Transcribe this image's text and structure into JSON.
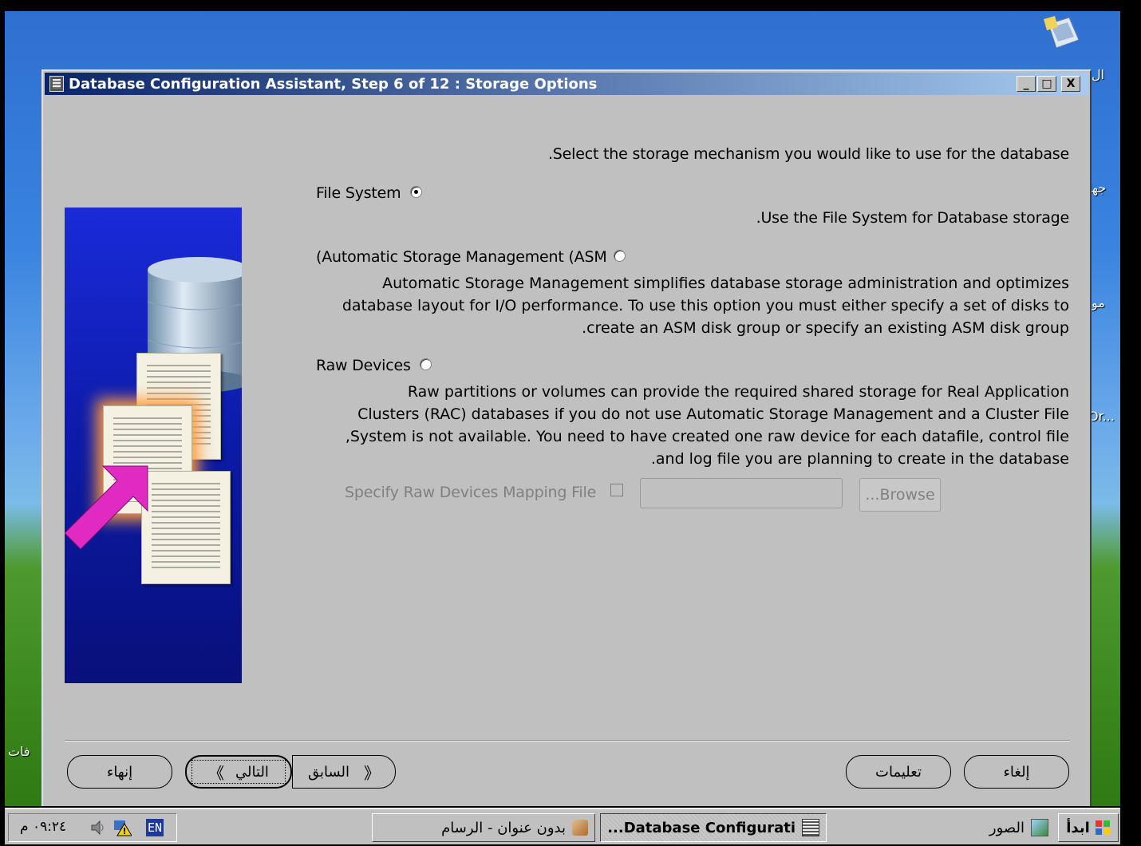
{
  "window": {
    "title": "Database Configuration Assistant, Step 6 of 12 : Storage Options",
    "minimize": "_",
    "maximize": "□",
    "close": "X"
  },
  "content": {
    "intro": ".Select the storage mechanism you would like to use for the database",
    "options": [
      {
        "label": "File System",
        "selected": true,
        "description": ".Use the File System for Database storage"
      },
      {
        "label": "(Automatic Storage Management (ASM",
        "selected": false,
        "description_lines": [
          "Automatic Storage Management simplifies database storage administration and optimizes",
          "database layout for I/O performance. To use this option you must either specify a set of disks to",
          ".create an ASM disk group or specify an existing ASM disk group"
        ]
      },
      {
        "label": "Raw Devices",
        "selected": false,
        "description_lines": [
          "Raw partitions or volumes can provide the required shared storage for Real Application",
          "Clusters (RAC) databases if you do not use Automatic Storage Management and a Cluster File",
          ",System is not available.  You need to have created one raw device for each datafile, control file",
          ".and log file you are planning to create in the database"
        ]
      }
    ],
    "raw_mapping": {
      "label": "Specify Raw Devices Mapping File",
      "checked": false,
      "value": "",
      "browse": "...Browse"
    }
  },
  "buttons": {
    "cancel": "إلغاء",
    "help": "تعليمات",
    "back": "السابق",
    "next": "التالي",
    "finish": "إنهاء"
  },
  "desktop": {
    "labels": [
      "جها",
      "مو",
      "Or...",
      "ال",
      "فات"
    ]
  },
  "taskbar": {
    "start": "ابدأ",
    "quick_launch": "الصور",
    "tasks": [
      {
        "label": "...Database Configurati",
        "active": true
      },
      {
        "label": "بدون عنوان - الرسام",
        "active": false
      }
    ],
    "language": "EN",
    "clock": "٠٩:٢٤ م"
  },
  "colors": {
    "titlebar_start": "#0a246a",
    "titlebar_end": "#a6caf0",
    "window_bg": "#c0c0c0",
    "side_panel": "#0c1aa8"
  }
}
